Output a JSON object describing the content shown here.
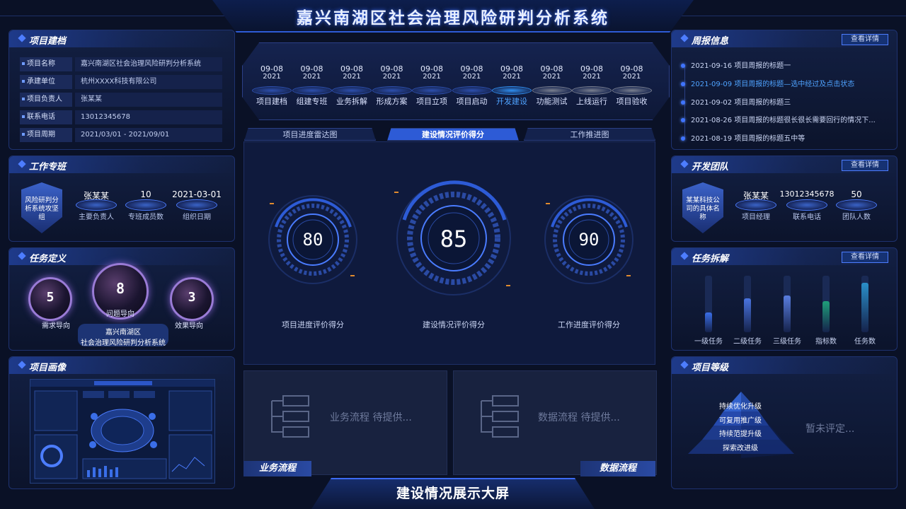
{
  "header": {
    "title": "嘉兴南湖区社会治理风险研判分析系统"
  },
  "footer": {
    "title": "建设情况展示大屏"
  },
  "project_info": {
    "title": "项目建档",
    "rows": [
      {
        "key": "项目名称",
        "value": "嘉兴南湖区社会治理风险研判分析系统"
      },
      {
        "key": "承建单位",
        "value": "杭州XXXX科技有限公司"
      },
      {
        "key": "项目负责人",
        "value": "张某某"
      },
      {
        "key": "联系电话",
        "value": "13012345678"
      },
      {
        "key": "项目周期",
        "value": "2021/03/01 - 2021/09/01"
      }
    ]
  },
  "work_team": {
    "title": "工作专班",
    "badge": "风险研判分析系统攻坚组",
    "stats": [
      {
        "value": "张某某",
        "label": "主要负责人"
      },
      {
        "value": "10",
        "label": "专班成员数"
      },
      {
        "value": "2021-03-01",
        "label": "组织日期"
      }
    ]
  },
  "task_def": {
    "title": "任务定义",
    "orbs": [
      {
        "value": "5",
        "label": "需求导向"
      },
      {
        "value": "8",
        "label": "问题导向"
      },
      {
        "value": "3",
        "label": "效果导向"
      }
    ],
    "caption_1": "嘉兴南湖区",
    "caption_2": "社会治理风险研判分析系统"
  },
  "project_image": {
    "title": "项目画像"
  },
  "phases": [
    {
      "date": "09-08",
      "year": "2021",
      "label": "项目建档",
      "state": "done"
    },
    {
      "date": "09-08",
      "year": "2021",
      "label": "组建专班",
      "state": "done"
    },
    {
      "date": "09-08",
      "year": "2021",
      "label": "业务拆解",
      "state": "done"
    },
    {
      "date": "09-08",
      "year": "2021",
      "label": "形成方案",
      "state": "done"
    },
    {
      "date": "09-08",
      "year": "2021",
      "label": "项目立项",
      "state": "done"
    },
    {
      "date": "09-08",
      "year": "2021",
      "label": "项目启动",
      "state": "done"
    },
    {
      "date": "09-08",
      "year": "2021",
      "label": "开发建设",
      "state": "current"
    },
    {
      "date": "09-08",
      "year": "2021",
      "label": "功能测试",
      "state": "todo"
    },
    {
      "date": "09-08",
      "year": "2021",
      "label": "上线运行",
      "state": "todo"
    },
    {
      "date": "09-08",
      "year": "2021",
      "label": "项目验收",
      "state": "todo"
    }
  ],
  "tabs": [
    {
      "label": "项目进度雷达图"
    },
    {
      "label": "建设情况评价得分"
    },
    {
      "label": "工作推进图"
    }
  ],
  "gauges": [
    {
      "value": "80",
      "label": "项目进度评价得分"
    },
    {
      "value": "85",
      "label": "建设情况评价得分"
    },
    {
      "value": "90",
      "label": "工作进度评价得分"
    }
  ],
  "business_flow": {
    "tag": "业务流程",
    "placeholder": "业务流程 待提供..."
  },
  "data_flow": {
    "tag": "数据流程",
    "placeholder": "数据流程 待提供..."
  },
  "weekly": {
    "title": "周报信息",
    "detail": "查看详情",
    "items": [
      {
        "text": "2021-09-16  项目周报的标题一"
      },
      {
        "text": "2021-09-09  项目周报的标题—选中经过及点击状态"
      },
      {
        "text": "2021-09-02  项目周报的标题三"
      },
      {
        "text": "2021-08-26  项目周报的标题很长很长需要回行的情况下..."
      },
      {
        "text": "2021-08-19  项目周报的标题五中等"
      }
    ]
  },
  "dev_team": {
    "title": "开发团队",
    "detail": "查看详情",
    "badge": "某某科技公司的具体名称",
    "stats": [
      {
        "value": "张某某",
        "label": "项目经理"
      },
      {
        "value": "13012345678",
        "label": "联系电话"
      },
      {
        "value": "50",
        "label": "团队人数"
      }
    ]
  },
  "task_breakdown": {
    "title": "任务拆解",
    "detail": "查看详情",
    "bars": [
      {
        "label": "一级任务",
        "fill": 0.35,
        "color": "#3a6ee8"
      },
      {
        "label": "二级任务",
        "fill": 0.6,
        "color": "#4a74e0"
      },
      {
        "label": "三级任务",
        "fill": 0.65,
        "color": "#5a7ee0"
      },
      {
        "label": "指标数",
        "fill": 0.55,
        "color": "#1f9e7a"
      },
      {
        "label": "任务数",
        "fill": 0.88,
        "color": "#2a8fc9"
      }
    ]
  },
  "project_level": {
    "title": "项目等级",
    "levels": [
      "持续优化升级",
      "可复用推广级",
      "持续范提升级",
      "探索改进级"
    ],
    "status": "暂未评定..."
  }
}
